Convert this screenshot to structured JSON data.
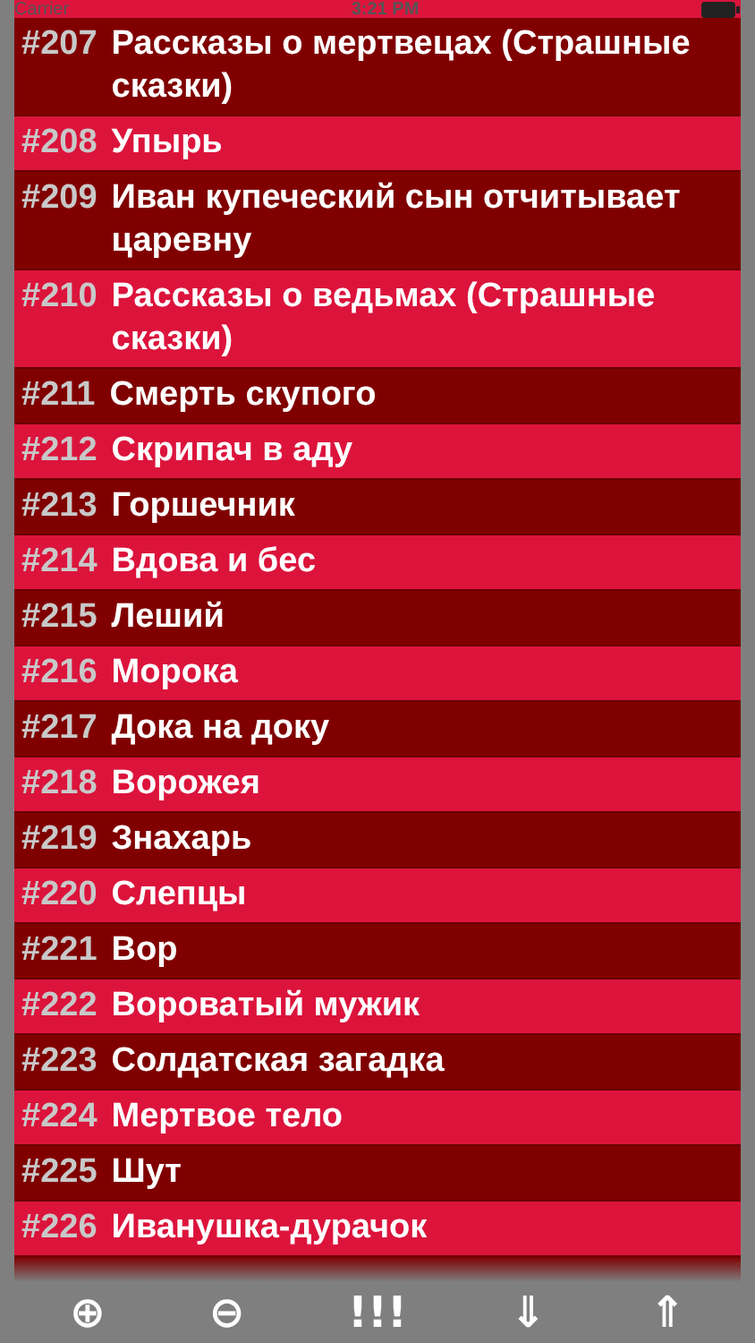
{
  "status_bar": {
    "carrier": "Carrier",
    "time": "3:21 PM"
  },
  "stories": [
    {
      "number": "#207",
      "title": "Рассказы о мертвецах (Страшные сказки)"
    },
    {
      "number": "#208",
      "title": "Упырь"
    },
    {
      "number": "#209",
      "title": "Иван купеческий сын отчитывает царевну"
    },
    {
      "number": "#210",
      "title": "Рассказы о ведьмах (Страшные сказки)"
    },
    {
      "number": "#211",
      "title": "Смерть скупого"
    },
    {
      "number": "#212",
      "title": "Скрипач в аду"
    },
    {
      "number": "#213",
      "title": "Горшечник"
    },
    {
      "number": "#214",
      "title": "Вдова и бес"
    },
    {
      "number": "#215",
      "title": "Леший"
    },
    {
      "number": "#216",
      "title": "Морока"
    },
    {
      "number": "#217",
      "title": "Дока на доку"
    },
    {
      "number": "#218",
      "title": "Ворожея"
    },
    {
      "number": "#219",
      "title": "Знахарь"
    },
    {
      "number": "#220",
      "title": "Слепцы"
    },
    {
      "number": "#221",
      "title": "Вор"
    },
    {
      "number": "#222",
      "title": "Вороватый мужик"
    },
    {
      "number": "#223",
      "title": "Солдатская загадка"
    },
    {
      "number": "#224",
      "title": "Мертвое тело"
    },
    {
      "number": "#225",
      "title": "Шут"
    },
    {
      "number": "#226",
      "title": "Иванушка-дурачок"
    }
  ],
  "toolbar": [
    "⊕",
    "⊖",
    "!!!",
    "⇓",
    "⇑"
  ]
}
